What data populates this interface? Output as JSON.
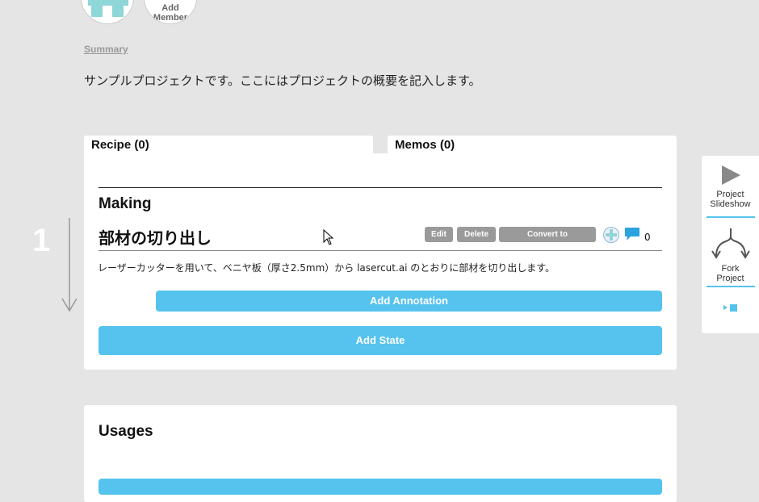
{
  "header": {
    "add_member": "Add\nMember"
  },
  "summary": {
    "label": "Summary",
    "text": "サンプルプロジェクトです。ここにはプロジェクトの概要を記入します。"
  },
  "tabs": [
    {
      "label": "Recipe (0)"
    },
    {
      "label": "Memos (0)"
    }
  ],
  "recipe": {
    "section_title": "Making",
    "step": {
      "number": "1",
      "title": "部材の切り出し",
      "buttons": {
        "edit": "Edit",
        "delete": "Delete",
        "convert": "Convert to Annotation"
      },
      "comment_count": "0",
      "description": "レーザーカッターを用いて、ベニヤ板（厚さ2.5mm）から lasercut.ai のとおりに部材を切り出します。"
    },
    "add_annotation": "Add Annotation",
    "add_state": "Add State"
  },
  "usages": {
    "title": "Usages"
  },
  "sidebar": {
    "slideshow": "Project\nSlideshow",
    "fork": "Fork\nProject"
  },
  "colors": {
    "accent": "#55c3ee",
    "background": "#e5e5e5",
    "button_gray": "#9a9a9a"
  }
}
